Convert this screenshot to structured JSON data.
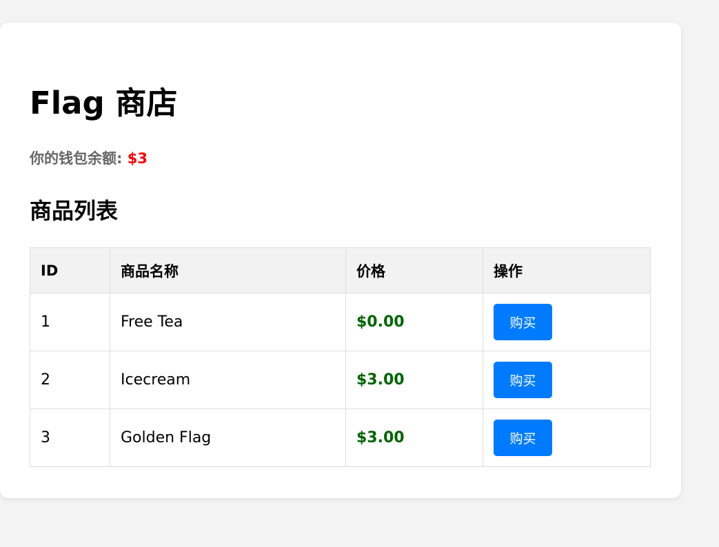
{
  "page": {
    "title": "Flag 商店",
    "wallet_label": "你的钱包余额: ",
    "wallet_balance": "$3",
    "section_title": "商品列表"
  },
  "table": {
    "headers": [
      "ID",
      "商品名称",
      "价格",
      "操作"
    ],
    "rows": [
      {
        "id": "1",
        "name": "Free Tea",
        "price": "$0.00",
        "action": "购买"
      },
      {
        "id": "2",
        "name": "Icecream",
        "price": "$3.00",
        "action": "购买"
      },
      {
        "id": "3",
        "name": "Golden Flag",
        "price": "$3.00",
        "action": "购买"
      }
    ]
  },
  "colors": {
    "page_background": "#f3f3f3",
    "balance": "#ff0000",
    "price": "#006400",
    "button": "#007bff"
  }
}
